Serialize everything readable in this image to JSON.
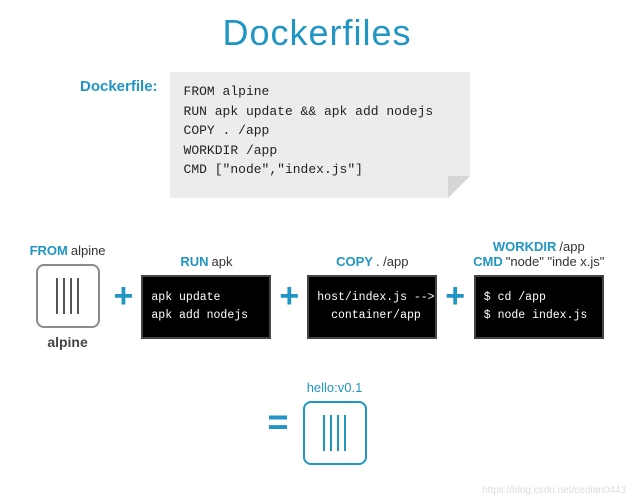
{
  "title": "Dockerfiles",
  "dockerfile": {
    "label": "Dockerfile:",
    "lines": [
      "FROM alpine",
      "RUN apk update && apk add nodejs",
      "COPY . /app",
      "WORKDIR /app",
      "CMD [\"node\",\"index.js\"]"
    ]
  },
  "steps": [
    {
      "kw": "FROM",
      "arg": "alpine",
      "type": "icon",
      "caption": "alpine"
    },
    {
      "kw": "RUN",
      "arg": "apk",
      "type": "term",
      "lines": [
        "apk update",
        "apk add nodejs"
      ]
    },
    {
      "kw": "COPY",
      "arg": ". /app",
      "type": "term",
      "lines": [
        "host/index.js -->",
        "  container/app"
      ]
    },
    {
      "kw": "WORKDIR",
      "arg": "/app",
      "kw2": "CMD",
      "arg2": "\"node\" \"inde x.js\"",
      "type": "term",
      "lines": [
        "$ cd /app",
        "$ node index.js"
      ]
    }
  ],
  "result": {
    "equals": "=",
    "label": "hello:v0.1"
  },
  "plus": "+",
  "watermark": "https://blog.csdn.net/cedian0443"
}
